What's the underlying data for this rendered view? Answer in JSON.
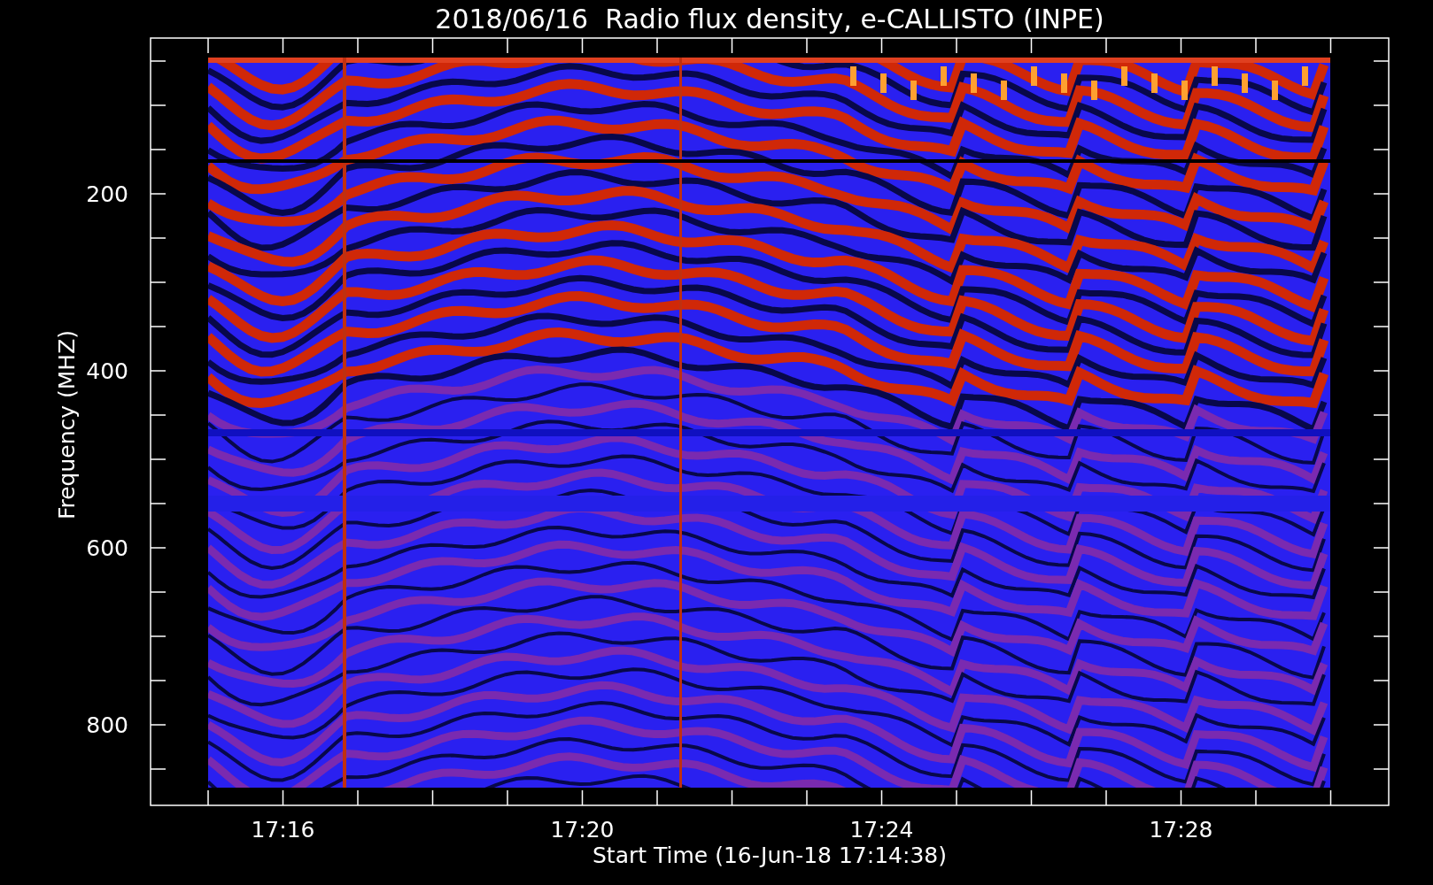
{
  "title": "2018/06/16  Radio flux density, e-CALLISTO (INPE)",
  "y_axis": {
    "label": "Frequency (MHZ)",
    "ticks": [
      "200",
      "400",
      "600",
      "800"
    ]
  },
  "x_axis": {
    "label": "Start Time (16-Jun-18 17:14:38)",
    "ticks": [
      "17:16",
      "17:20",
      "17:24",
      "17:28"
    ]
  }
}
